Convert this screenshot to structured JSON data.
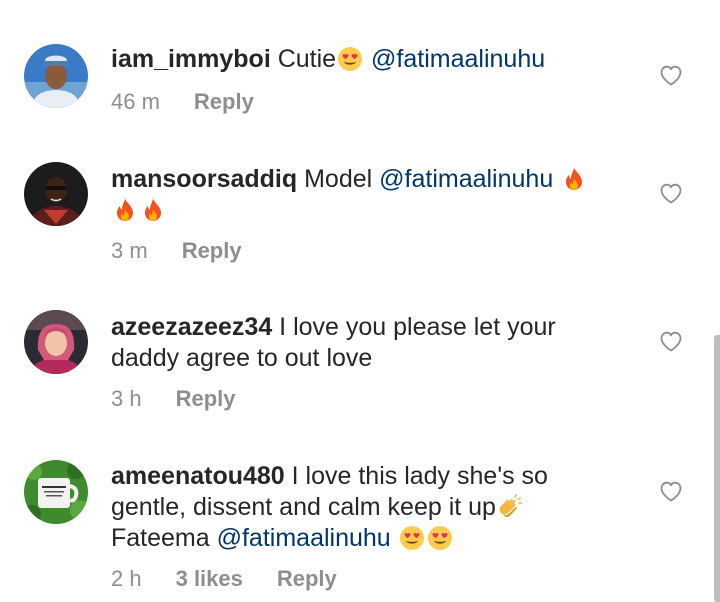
{
  "comments": [
    {
      "username": "iam_immyboi",
      "text_before": " Cutie",
      "emoji_after_text": "heart-eyes",
      "mention": "@fatimaalinuhu",
      "line2": "",
      "time": "46 m",
      "reply_label": "Reply"
    },
    {
      "username": "mansoorsaddiq",
      "text_before": " Model ",
      "mention": "@fatimaalinuhu",
      "emojis": [
        "fire",
        "fire",
        "fire"
      ],
      "time": "3 m",
      "reply_label": "Reply"
    },
    {
      "username": "azeezazeez34",
      "text_line1": " I love you please let your",
      "text_line2": "daddy agree to out love",
      "time": "3 h",
      "reply_label": "Reply"
    },
    {
      "username": "ameenatou480",
      "text_line1": " I love this lady she's so",
      "text_line2": "gentle, dissent and calm keep it up",
      "text_line3": "Fateema ",
      "mention": "@fatimaalinuhu",
      "emojis": [
        "clapping-hands",
        "heart-eyes",
        "heart-eyes"
      ],
      "time": "2 h",
      "likes": "3 likes",
      "reply_label": "Reply"
    }
  ],
  "colors": {
    "text": "#262626",
    "meta": "#8e8e8e",
    "mention": "#00376b",
    "background": "#ffffff"
  }
}
